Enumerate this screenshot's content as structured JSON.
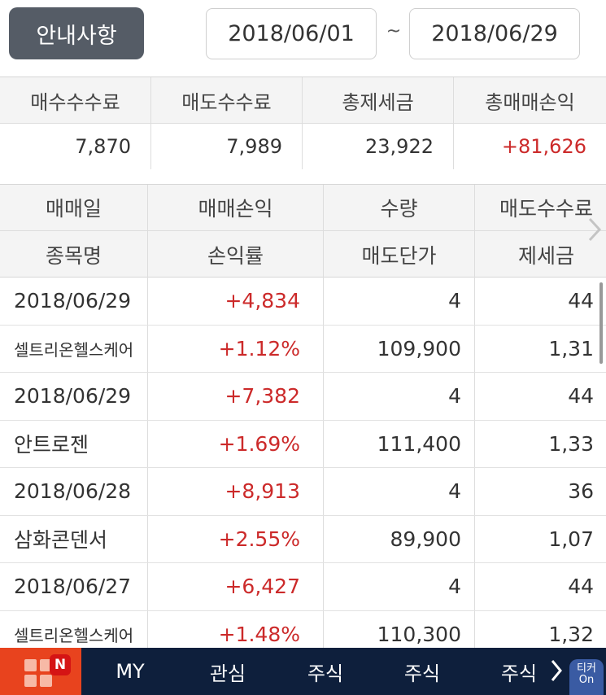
{
  "header": {
    "notice_label": "안내사항",
    "date_start": "2018/06/01",
    "date_separator": "~",
    "date_end": "2018/06/29"
  },
  "summary": {
    "headers": [
      "매수수수료",
      "매도수수료",
      "총제세금",
      "총매매손익"
    ],
    "values": [
      "7,870",
      "7,989",
      "23,922",
      "+81,626"
    ]
  },
  "table": {
    "header_row1": [
      "매매일",
      "매매손익",
      "수량",
      "매도수수료"
    ],
    "header_row2": [
      "종목명",
      "손익률",
      "매도단가",
      "제세금"
    ],
    "rows": [
      [
        "2018/06/29",
        "+4,834",
        "4",
        "44"
      ],
      [
        "셀트리온헬스케어",
        "+1.12%",
        "109,900",
        "1,31"
      ],
      [
        "2018/06/29",
        "+7,382",
        "4",
        "44"
      ],
      [
        "안트로젠",
        "+1.69%",
        "111,400",
        "1,33"
      ],
      [
        "2018/06/28",
        "+8,913",
        "4",
        "36"
      ],
      [
        "삼화콘덴서",
        "+2.55%",
        "89,900",
        "1,07"
      ],
      [
        "2018/06/27",
        "+6,427",
        "4",
        "44"
      ],
      [
        "셀트리온헬스케어",
        "+1.48%",
        "110,300",
        "1,32"
      ]
    ]
  },
  "bottom_nav": {
    "menu_badge": "N",
    "items": [
      "MY",
      "관심",
      "주식",
      "주식",
      "주식"
    ],
    "ticker_label": "티커",
    "ticker_state": "On"
  },
  "colors": {
    "profit": "#cc2a2a",
    "nav_bg": "#0e1f3c",
    "menu_bg": "#e8431e",
    "notice_bg": "#555c66"
  },
  "icons": {
    "scroll_right": "chevron-right-icon",
    "menu": "grid-menu-icon",
    "nav_more": "chevron-right-icon"
  }
}
